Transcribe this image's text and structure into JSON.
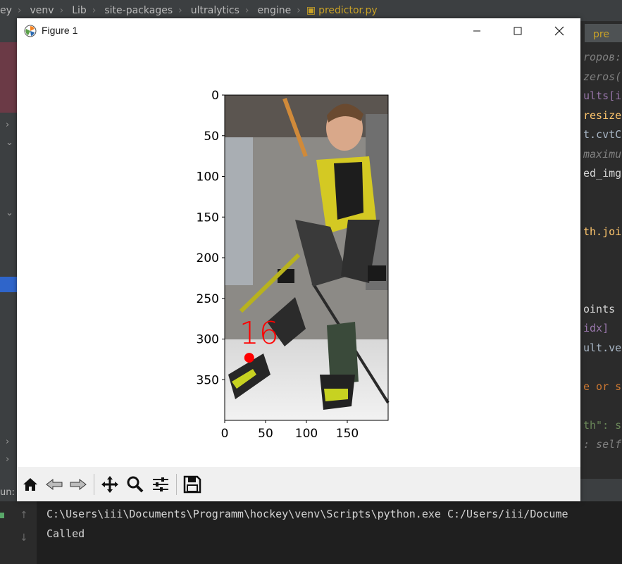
{
  "ide": {
    "breadcrumb": [
      "ey",
      "venv",
      "Lib",
      "site-packages",
      "ultralytics",
      "engine",
      "predictor.py"
    ],
    "right_tab_label": "pre",
    "code_fragments": [
      "ropов:",
      "zeros(",
      "ults[i",
      "resize",
      "t.cvtCo",
      "maximu",
      "ed_img)",
      "th.joi",
      "oints",
      "idx]",
      "ult.ve",
      "e or se",
      "th\": s",
      ": self"
    ],
    "run_label": "un:",
    "console": {
      "lines": [
        "C:\\Users\\iii\\Documents\\Programm\\hockey\\venv\\Scripts\\python.exe C:/Users/iii/Docume",
        "Called"
      ]
    },
    "colors": {
      "accent_blue": "#2f65ca",
      "file_yellow": "#c9a227",
      "bg": "#2b2b2b"
    }
  },
  "window": {
    "title": "Figure 1",
    "icons": {
      "app": "matplotlib-icon",
      "minimize": "minimize-icon",
      "maximize": "maximize-icon",
      "close": "close-icon"
    }
  },
  "toolbar": {
    "buttons": [
      "home-icon",
      "back-icon",
      "forward-icon",
      "pan-icon",
      "zoom-icon",
      "configure-subplots-icon",
      "save-icon"
    ]
  },
  "chart_data": {
    "type": "image",
    "title": "",
    "xlabel": "",
    "ylabel": "",
    "xlim": [
      0,
      200
    ],
    "ylim": [
      400,
      0
    ],
    "x_ticks": [
      "0",
      "50",
      "100",
      "150"
    ],
    "y_ticks": [
      "0",
      "50",
      "100",
      "150",
      "200",
      "250",
      "300",
      "350"
    ],
    "annotation": {
      "label": "16",
      "x": 30,
      "y": 323,
      "color": "#ff0000"
    }
  }
}
